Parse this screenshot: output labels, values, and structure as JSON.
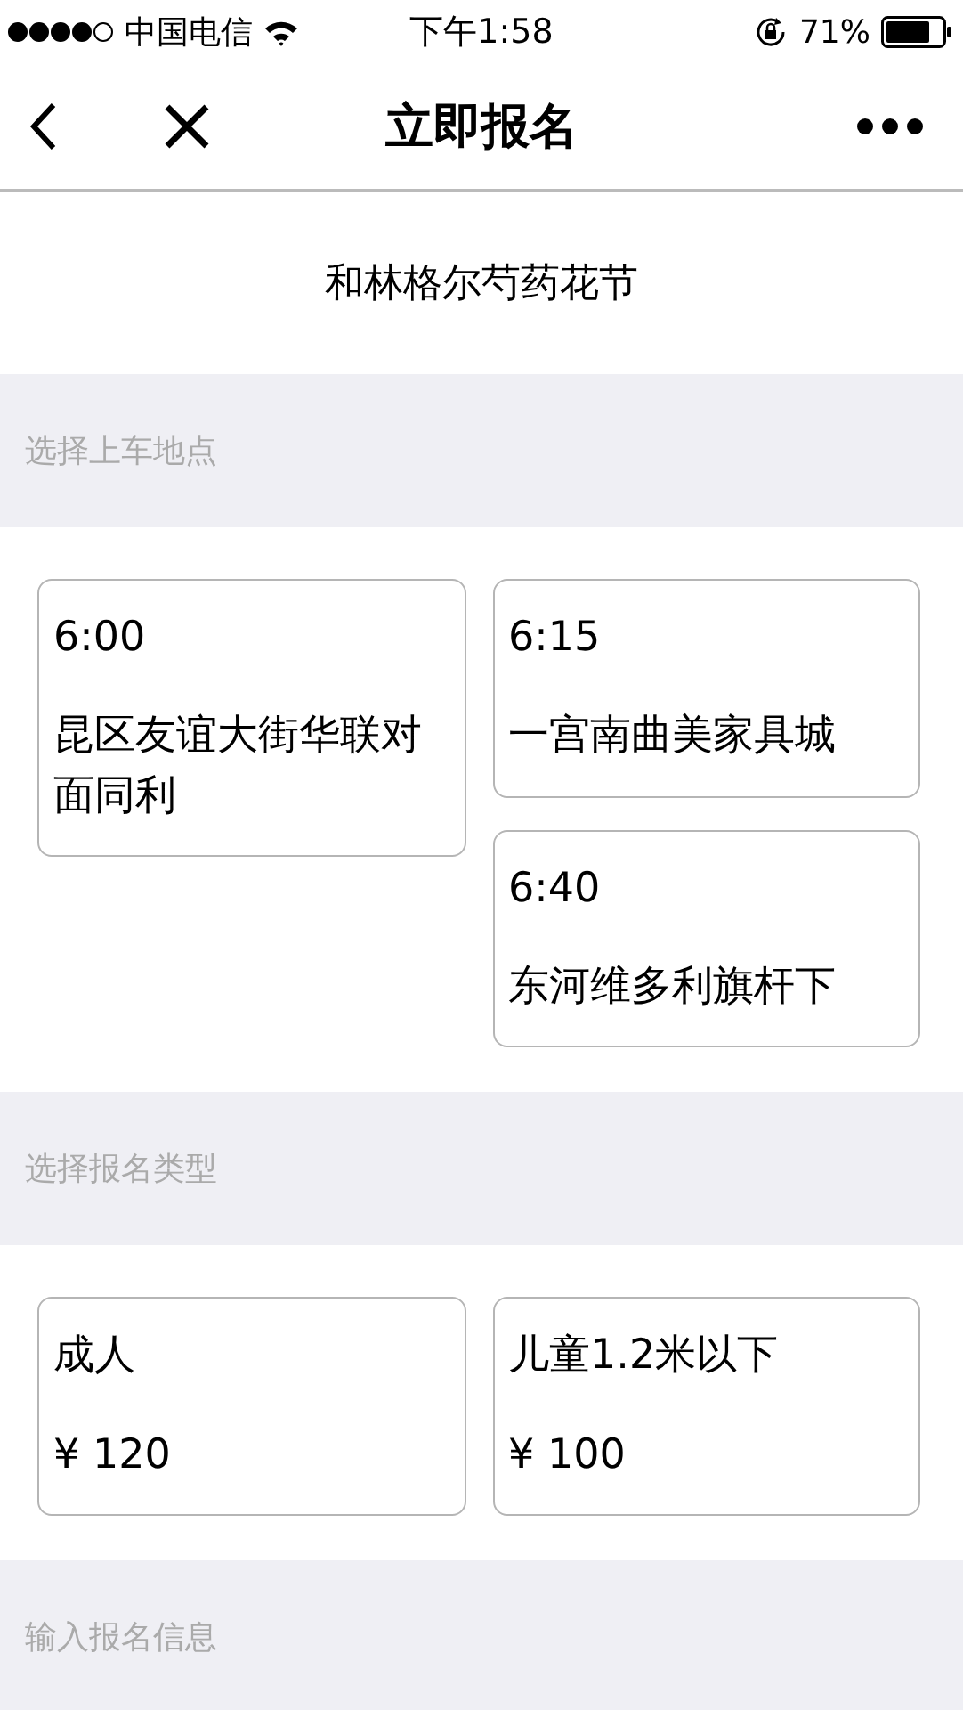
{
  "status_bar": {
    "carrier": "中国电信",
    "time": "下午1:58",
    "battery": "71%"
  },
  "nav": {
    "title": "立即报名"
  },
  "event": {
    "name": "和林格尔芍药花节"
  },
  "pickup_section": {
    "label": "选择上车地点"
  },
  "pickup_points": [
    {
      "time": "6:00",
      "place": "昆区友谊大街华联对面同利"
    },
    {
      "time": "6:15",
      "place": "一宫南曲美家具城"
    },
    {
      "time": "6:40",
      "place": "东河维多利旗杆下"
    }
  ],
  "type_section": {
    "label": "选择报名类型"
  },
  "ticket_types": [
    {
      "name": "成人",
      "price": "¥ 120"
    },
    {
      "name": "儿童1.2米以下",
      "price": "¥ 100"
    }
  ],
  "info_section": {
    "label": "输入报名信息"
  }
}
